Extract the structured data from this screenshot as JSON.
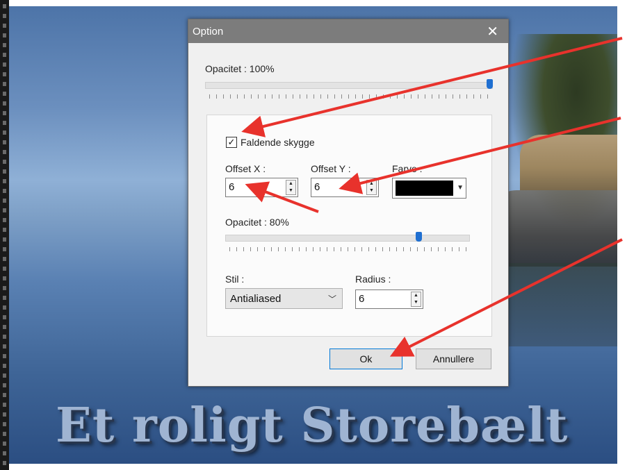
{
  "dialog": {
    "title": "Option",
    "close_glyph": "✕",
    "opacity_label": "Opacitet : 100%",
    "opacity_value": 100,
    "shadow": {
      "checkbox_label": "Faldende skygge",
      "checkbox_checked": true,
      "check_glyph": "✓",
      "offset_x_label": "Offset X :",
      "offset_x_value": "6",
      "offset_y_label": "Offset Y :",
      "offset_y_value": "6",
      "color_label": "Farve :",
      "color_value": "#000000",
      "opacity_label": "Opacitet : 80%",
      "opacity_value": 80,
      "style_label": "Stil :",
      "style_value": "Antialiased",
      "radius_label": "Radius :",
      "radius_value": "6"
    },
    "ok_label": "Ok",
    "cancel_label": "Annullere"
  },
  "background": {
    "caption": "Et roligt Storebælt"
  },
  "annotations": {
    "arrow_color": "#e8322c",
    "arrow_count": 4
  }
}
